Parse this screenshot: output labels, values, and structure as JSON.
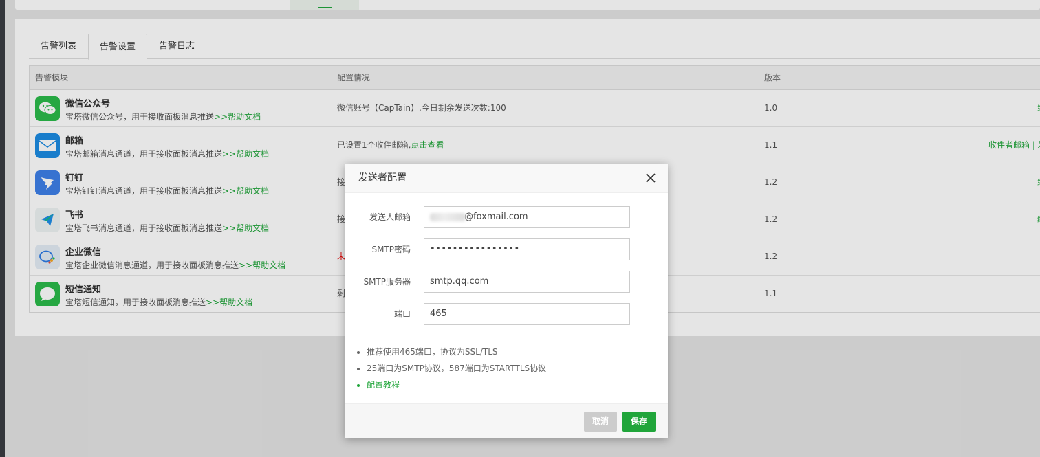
{
  "tabs": [
    {
      "label": "告警列表"
    },
    {
      "label": "告警设置"
    },
    {
      "label": "告警日志"
    }
  ],
  "table": {
    "headers": {
      "module": "告警模块",
      "config": "配置情况",
      "version": "版本"
    },
    "rows": [
      {
        "name": "微信公众号",
        "desc": "宝塔微信公众号，用于接收面板消息推送",
        "help": ">>帮助文档",
        "config": "微信账号【CapTain】,今日剩余发送次数:100",
        "config_link": "",
        "version": "1.0",
        "op": "绑"
      },
      {
        "name": "邮箱",
        "desc": "宝塔邮箱消息通道，用于接收面板消息推送",
        "help": ">>帮助文档",
        "config": "已设置1个收件邮箱,",
        "config_link": "点击查看",
        "version": "1.1",
        "op": "收件者邮箱 | 发"
      },
      {
        "name": "钉钉",
        "desc": "宝塔钉钉消息通道，用于接收面板消息推送",
        "help": ">>帮助文档",
        "config": "接",
        "config_link": "",
        "version": "1.2",
        "op": "绑"
      },
      {
        "name": "飞书",
        "desc": "宝塔飞书消息通道，用于接收面板消息推送",
        "help": ">>帮助文档",
        "config": "接",
        "config_link": "",
        "version": "1.2",
        "op": "绑"
      },
      {
        "name": "企业微信",
        "desc": "宝塔企业微信消息通道，用于接收面板消息推送",
        "help": ">>帮助文档",
        "config": "未",
        "config_link": "",
        "version": "1.2",
        "op": ""
      },
      {
        "name": "短信通知",
        "desc": "宝塔短信通知，用于接收面板消息推送",
        "help": ">>帮助文档",
        "config": "剩",
        "config_link": "",
        "version": "1.1",
        "op": ""
      }
    ]
  },
  "dialog": {
    "title": "发送者配置",
    "fields": [
      {
        "label": "发送人邮箱",
        "value": "@foxmail.com"
      },
      {
        "label": "SMTP密码",
        "value": "••••••••••••••••"
      },
      {
        "label": "SMTP服务器",
        "value": "smtp.qq.com"
      },
      {
        "label": "端口",
        "value": "465"
      }
    ],
    "tips": [
      "推荐使用465端口，协议为SSL/TLS",
      "25端口为SMTP协议，587端口为STARTTLS协议",
      "配置教程"
    ],
    "cancel_label": "取消",
    "save_label": "保存"
  },
  "colors": {
    "accent": "#20a53a",
    "error": "#ee0000",
    "email_icon": "#1c8ce3",
    "dingtalk_icon": "#3e7fe8"
  },
  "icons": [
    "wechat-icon",
    "mail-icon",
    "dingtalk-icon",
    "feishu-icon",
    "wecom-icon",
    "sms-icon",
    "close-icon"
  ]
}
